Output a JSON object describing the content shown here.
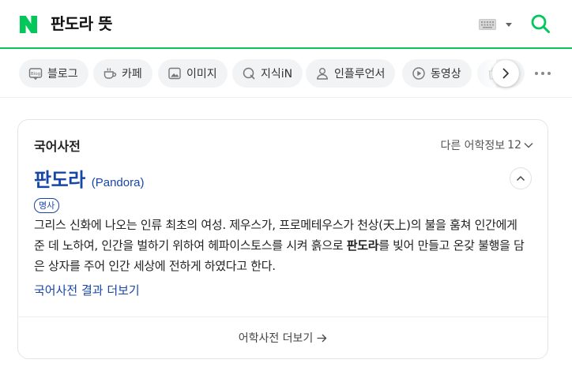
{
  "header": {
    "logo_icon": "naver-n-logo-icon",
    "logo_color": "#03c75a",
    "query": "판도라 뜻",
    "keyboard_icon": "keyboard-icon",
    "search_icon": "search-icon"
  },
  "tabs": [
    {
      "label": "블로그",
      "icon": "blog-icon"
    },
    {
      "label": "카페",
      "icon": "cafe-cup-icon"
    },
    {
      "label": "이미지",
      "icon": "image-icon"
    },
    {
      "label": "지식iN",
      "icon": "qna-icon"
    },
    {
      "label": "인플루언서",
      "icon": "person-icon"
    },
    {
      "label": "동영상",
      "icon": "play-icon"
    },
    {
      "label": "",
      "icon": "shopping-bag-icon"
    }
  ],
  "dictionary": {
    "title": "국어사전",
    "more_info_label": "다른 어학정보",
    "more_info_count": "12",
    "entry_word": "판도라",
    "entry_original": "(Pandora)",
    "part_of_speech": "명사",
    "definition_before": "그리스 신화에 나오는 인류 최초의 여성. 제우스가, 프로메테우스가 천상(天上)의 불을 훔쳐 인간에게 준 데 노하여, 인간을 벌하기 위하여 헤파이스토스를 시켜 흙으로 ",
    "definition_bold": "판도라",
    "definition_after": "를 빚어 만들고 온갖 불행을 담은 상자를 주어 인간 세상에 전하게 하였다고 한다.",
    "more_results_link": "국어사전 결과 더보기",
    "footer_link": "어학사전 더보기",
    "link_color": "#1846a7"
  }
}
